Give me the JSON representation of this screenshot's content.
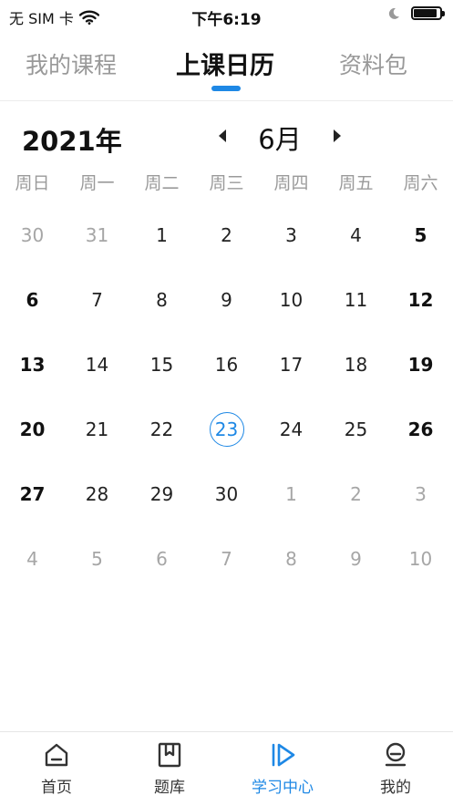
{
  "status_bar": {
    "carrier": "无 SIM 卡",
    "time": "下午6:19",
    "battery_level": 0.9,
    "icons": [
      "wifi-icon",
      "moon-icon",
      "battery-icon"
    ]
  },
  "tabs": [
    {
      "label": "我的课程",
      "active": false
    },
    {
      "label": "上课日历",
      "active": true
    },
    {
      "label": "资料包",
      "active": false
    }
  ],
  "calendar": {
    "year_label": "2021年",
    "month_label": "6月",
    "weekdays": [
      "周日",
      "周一",
      "周二",
      "周三",
      "周四",
      "周五",
      "周六"
    ],
    "days": [
      {
        "n": "30",
        "m": true
      },
      {
        "n": "31",
        "m": true
      },
      {
        "n": "1"
      },
      {
        "n": "2"
      },
      {
        "n": "3"
      },
      {
        "n": "4"
      },
      {
        "n": "5",
        "b": true
      },
      {
        "n": "6",
        "b": true
      },
      {
        "n": "7"
      },
      {
        "n": "8"
      },
      {
        "n": "9"
      },
      {
        "n": "10"
      },
      {
        "n": "11"
      },
      {
        "n": "12",
        "b": true
      },
      {
        "n": "13",
        "b": true
      },
      {
        "n": "14"
      },
      {
        "n": "15"
      },
      {
        "n": "16"
      },
      {
        "n": "17"
      },
      {
        "n": "18"
      },
      {
        "n": "19",
        "b": true
      },
      {
        "n": "20",
        "b": true
      },
      {
        "n": "21"
      },
      {
        "n": "22"
      },
      {
        "n": "23",
        "s": true
      },
      {
        "n": "24"
      },
      {
        "n": "25"
      },
      {
        "n": "26",
        "b": true
      },
      {
        "n": "27",
        "b": true
      },
      {
        "n": "28"
      },
      {
        "n": "29"
      },
      {
        "n": "30"
      },
      {
        "n": "1",
        "m": true
      },
      {
        "n": "2",
        "m": true
      },
      {
        "n": "3",
        "m": true
      },
      {
        "n": "4",
        "m": true
      },
      {
        "n": "5",
        "m": true
      },
      {
        "n": "6",
        "m": true
      },
      {
        "n": "7",
        "m": true
      },
      {
        "n": "8",
        "m": true
      },
      {
        "n": "9",
        "m": true
      },
      {
        "n": "10",
        "m": true
      }
    ]
  },
  "bottom_nav": [
    {
      "label": "首页",
      "icon": "home-icon",
      "active": false
    },
    {
      "label": "题库",
      "icon": "bookmark-icon",
      "active": false
    },
    {
      "label": "学习中心",
      "icon": "play-icon",
      "active": true
    },
    {
      "label": "我的",
      "icon": "profile-icon",
      "active": false
    }
  ],
  "colors": {
    "accent": "#1e88e5",
    "muted": "#a6a6a6"
  }
}
